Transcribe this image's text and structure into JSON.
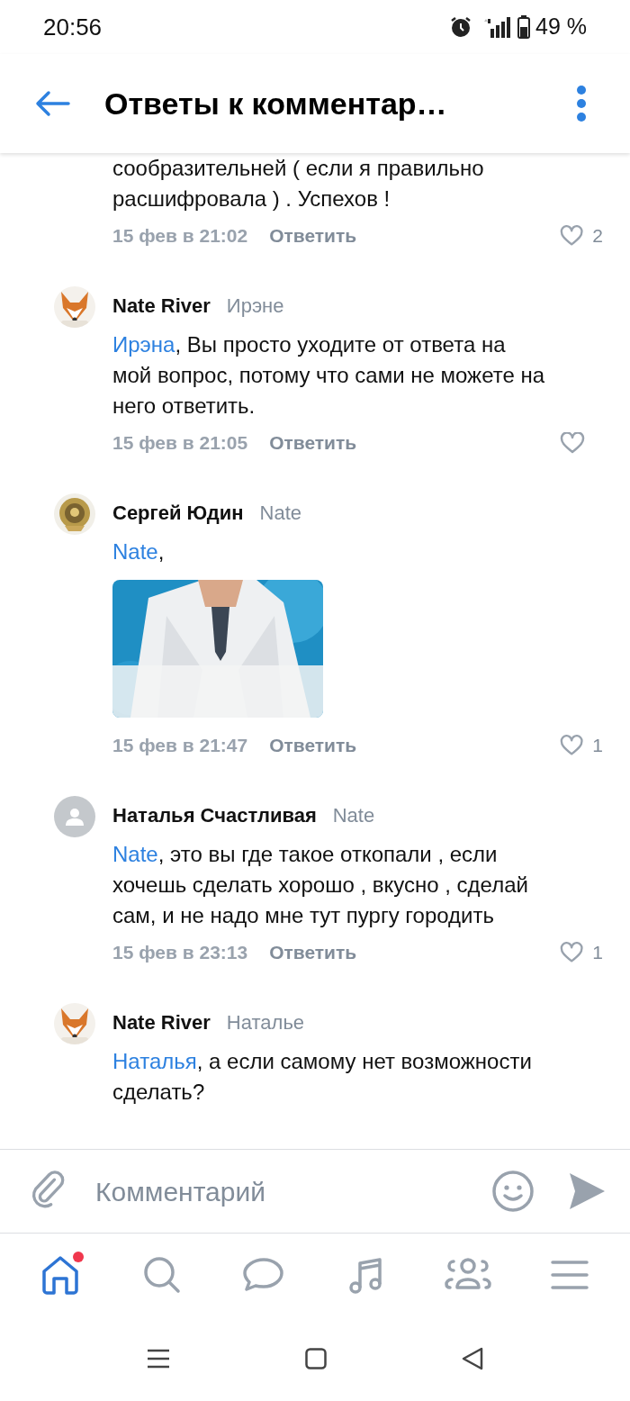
{
  "status_bar": {
    "time": "20:56",
    "battery": "49 %"
  },
  "header": {
    "title": "Ответы к комментар…"
  },
  "comments": [
    {
      "text": "сообразительней ( если я правильно расшифровала ) . Успехов !",
      "date": "15 фев в 21:02",
      "reply": "Ответить",
      "likes": "2"
    },
    {
      "author": "Nate River",
      "reply_to": "Ирэне",
      "avatar": {
        "kind": "fox"
      },
      "mention": "Ирэна",
      "text": ", Вы просто уходите от ответа на мой вопрос, потому что сами не можете на него ответить.",
      "date": "15 фев в 21:05",
      "reply": "Ответить"
    },
    {
      "author": "Сергей Юдин",
      "reply_to": "Nate",
      "avatar": {
        "kind": "emblem"
      },
      "mention": "Nate",
      "text": ",",
      "date": "15 фев в 21:47",
      "reply": "Ответить",
      "likes": "1"
    },
    {
      "author": "Наталья Счастливая",
      "reply_to": "Nate",
      "avatar": {
        "kind": "default"
      },
      "mention": "Nate",
      "text": ", это вы где такое откопали , если хочешь сделать хорошо , вкусно , сделай сам, и не надо мне тут пургу городить",
      "date": "15 фев в 23:13",
      "reply": "Ответить",
      "likes": "1"
    },
    {
      "author": "Nate River",
      "reply_to": "Наталье",
      "avatar": {
        "kind": "fox"
      },
      "mention": "Наталья",
      "text": ", а если самому нет возможности сделать?"
    }
  ],
  "composer": {
    "placeholder": "Комментарий"
  },
  "tabs": [
    {
      "kind": "home",
      "selected": true,
      "badge": true
    },
    {
      "kind": "search",
      "selected": false,
      "badge": false
    },
    {
      "kind": "messages",
      "selected": false,
      "badge": false
    },
    {
      "kind": "music",
      "selected": false,
      "badge": false
    },
    {
      "kind": "friends",
      "selected": false,
      "badge": false
    },
    {
      "kind": "menu",
      "selected": false,
      "badge": false
    }
  ]
}
